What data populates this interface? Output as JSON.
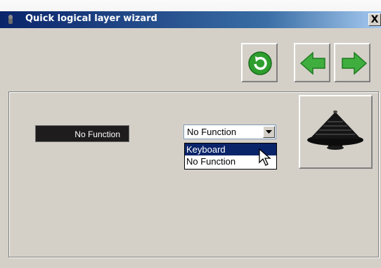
{
  "window": {
    "title": "Quick logical layer wizard",
    "close_label": "X"
  },
  "toolbar": {
    "buttons": [
      {
        "icon": "refresh-icon"
      },
      {
        "icon": "arrow-left-icon"
      },
      {
        "icon": "arrow-right-icon"
      }
    ]
  },
  "function_label": "No Function",
  "select": {
    "value": "No Function",
    "options": [
      "Keyboard",
      "No Function"
    ],
    "highlighted": "Keyboard"
  },
  "preview": {
    "icon": "joystick-hat-icon"
  },
  "colors": {
    "title_bar": "#0a246a",
    "button_green": "#3fae3f",
    "refresh_green": "#2e9e2e"
  }
}
